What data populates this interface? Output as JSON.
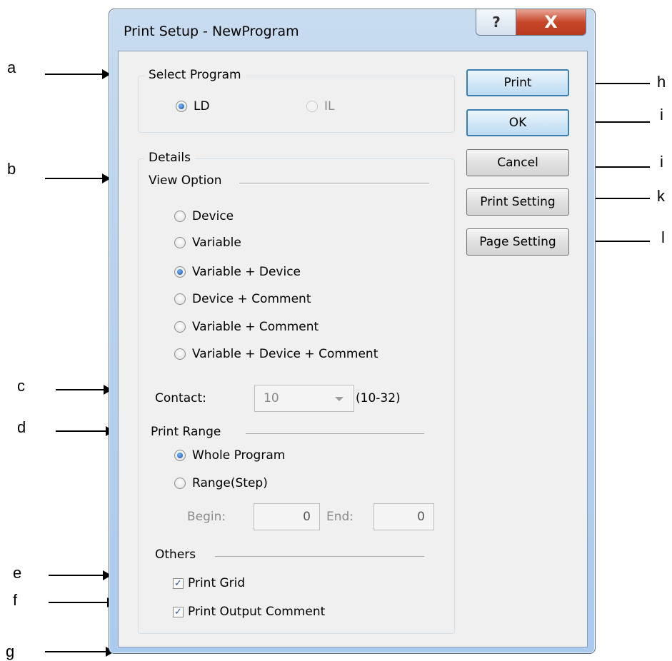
{
  "window": {
    "title": "Print Setup - NewProgram",
    "help_glyph": "?",
    "close_glyph": "X"
  },
  "select_program": {
    "title": "Select Program",
    "options": [
      {
        "label": "LD",
        "checked": true,
        "disabled": false
      },
      {
        "label": "IL",
        "checked": false,
        "disabled": true
      }
    ]
  },
  "details": {
    "title": "Details",
    "view_option": {
      "label": "View Option",
      "options": [
        {
          "label": "Device",
          "checked": false
        },
        {
          "label": "Variable",
          "checked": false
        },
        {
          "label": "Variable + Device",
          "checked": true
        },
        {
          "label": "Device + Comment",
          "checked": false
        },
        {
          "label": "Variable + Comment",
          "checked": false
        },
        {
          "label": "Variable + Device + Comment",
          "checked": false
        }
      ]
    },
    "contact": {
      "label": "Contact:",
      "value": "10",
      "range": "(10-32)"
    },
    "print_range": {
      "label": "Print Range",
      "options": [
        {
          "label": "Whole Program",
          "checked": true
        },
        {
          "label": "Range(Step)",
          "checked": false
        }
      ],
      "begin_label": "Begin:",
      "begin_value": "0",
      "end_label": "End:",
      "end_value": "0"
    },
    "others": {
      "label": "Others",
      "checks": [
        {
          "label": "Print Grid",
          "checked": true
        },
        {
          "label": "Print Output Comment",
          "checked": true
        }
      ]
    }
  },
  "buttons": {
    "print": "Print",
    "ok": "OK",
    "cancel": "Cancel",
    "print_setting": "Print Setting",
    "page_setting": "Page Setting"
  },
  "annotations": {
    "a": "a",
    "b": "b",
    "c": "c",
    "d": "d",
    "e": "e",
    "f": "f",
    "g": "g",
    "h": "h",
    "i1": "i",
    "i2": "i",
    "k": "k",
    "l": "l"
  },
  "colors": {
    "window_frame": "#b9d2ec",
    "close_button": "#c7462a",
    "default_button_border": "#3c7fb1",
    "radio_dot": "#1a4f9e"
  }
}
